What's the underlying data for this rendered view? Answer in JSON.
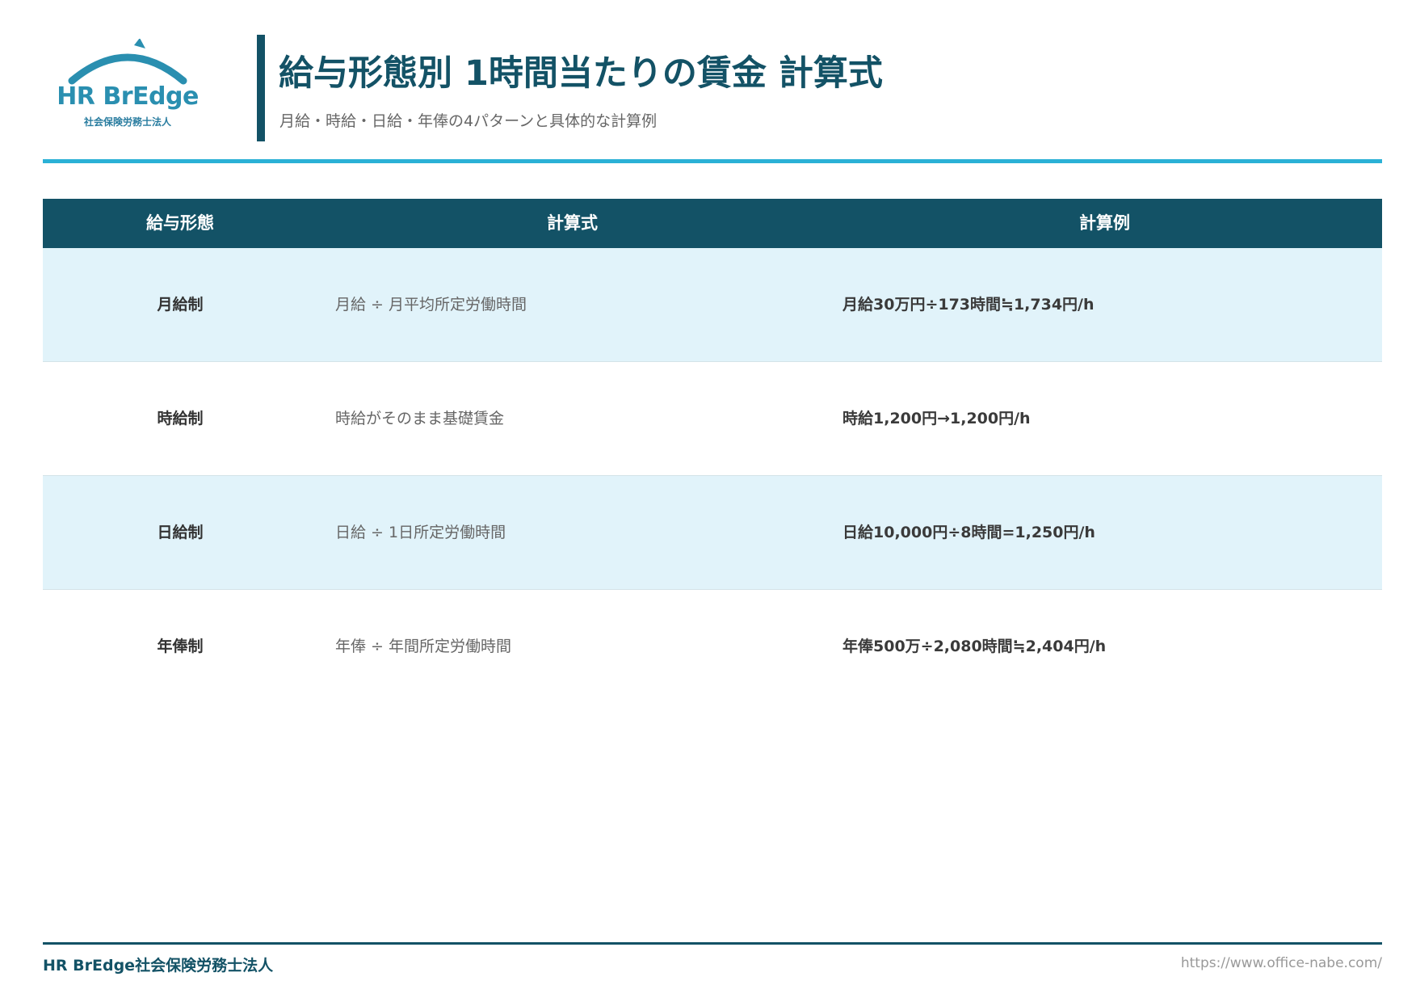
{
  "logo": {
    "name": "HR BrEdge",
    "subname": "社会保険労務士法人",
    "color": "#2a8fb0"
  },
  "header": {
    "title": "給与形態別 1時間当たりの賃金 計算式",
    "subtitle": "月給・時給・日給・年俸の4パターンと具体的な計算例"
  },
  "table": {
    "columns": [
      "給与形態",
      "計算式",
      "計算例"
    ],
    "rows": [
      {
        "type": "月給制",
        "formula": "月給 ÷ 月平均所定労働時間",
        "example": "月給30万円÷173時間≒1,734円/h"
      },
      {
        "type": "時給制",
        "formula": "時給がそのまま基礎賃金",
        "example": "時給1,200円→1,200円/h"
      },
      {
        "type": "日給制",
        "formula": "日給 ÷ 1日所定労働時間",
        "example": "日給10,000円÷8時間=1,250円/h"
      },
      {
        "type": "年俸制",
        "formula": "年俸 ÷ 年間所定労働時間",
        "example": "年俸500万÷2,080時間≒2,404円/h"
      }
    ]
  },
  "footer": {
    "company": "HR BrEdge社会保険労務士法人",
    "url": "https://www.office-nabe.com/"
  },
  "colors": {
    "primary": "#135266",
    "accent": "#2bb1d6",
    "row_shade": "#e1f3fa"
  }
}
